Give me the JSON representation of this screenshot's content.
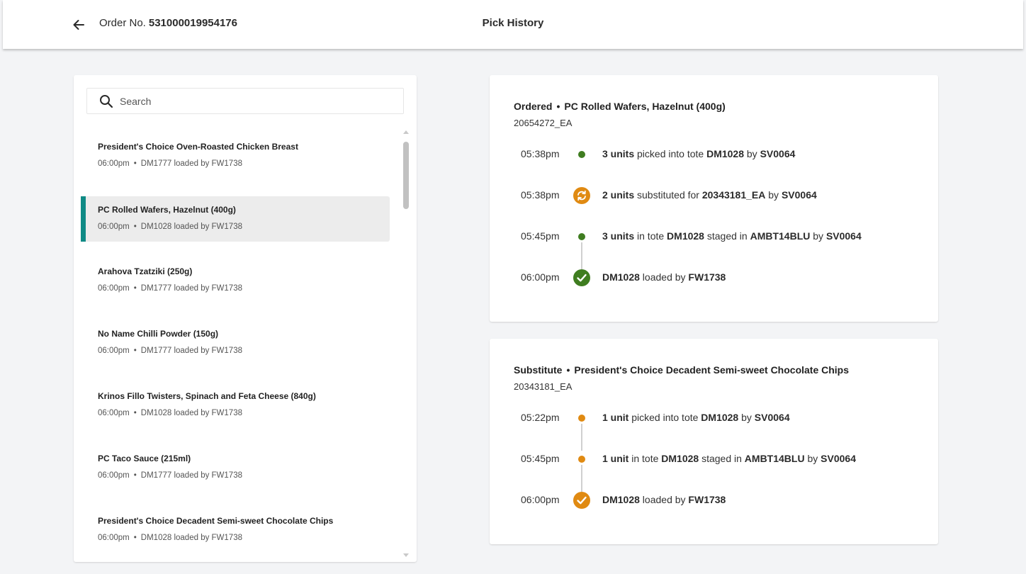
{
  "header": {
    "order_label": "Order No.",
    "order_number": "531000019954176",
    "title": "Pick History"
  },
  "search": {
    "placeholder": "Search"
  },
  "items": [
    {
      "name": "President's Choice Oven-Roasted Chicken Breast",
      "time": "06:00pm",
      "sep": "•",
      "detail": "DM1777 loaded by FW1738"
    },
    {
      "name": "PC Rolled Wafers, Hazelnut (400g)",
      "time": "06:00pm",
      "sep": "•",
      "detail": "DM1028 loaded by FW1738"
    },
    {
      "name": "Arahova Tzatziki (250g)",
      "time": "06:00pm",
      "sep": "•",
      "detail": "DM1777 loaded by FW1738"
    },
    {
      "name": "No Name Chilli Powder (150g)",
      "time": "06:00pm",
      "sep": "•",
      "detail": "DM1777 loaded by FW1738"
    },
    {
      "name": "Krinos Fillo Twisters, Spinach and Feta Cheese (840g)",
      "time": "06:00pm",
      "sep": "•",
      "detail": "DM1028 loaded by FW1738"
    },
    {
      "name": "PC Taco Sauce (215ml)",
      "time": "06:00pm",
      "sep": "•",
      "detail": "DM1777 loaded by FW1738"
    },
    {
      "name": "President's Choice Decadent Semi-sweet Chocolate Chips",
      "time": "06:00pm",
      "sep": "•",
      "detail": "DM1028 loaded by FW1738"
    }
  ],
  "selected_item": "PC Rolled Wafers, Hazelnut (400g)",
  "ordered": {
    "type": "Ordered",
    "sep": "•",
    "product": "PC Rolled Wafers, Hazelnut (400g)",
    "sku": "20654272_EA",
    "events": [
      {
        "time": "05:38pm",
        "marker": "green-dot",
        "p1": "3 units",
        "t1": " picked into tote ",
        "p2": "DM1028",
        "t2": " by ",
        "p3": "SV0064"
      },
      {
        "time": "05:38pm",
        "marker": "orange-substitute-icon",
        "p1": "2 units",
        "t1": " substituted for ",
        "p2": "20343181_EA",
        "t2": " by ",
        "p3": "SV0064"
      },
      {
        "time": "05:45pm",
        "marker": "green-dot",
        "p1": "3 units",
        "t1": " in tote ",
        "p2": "DM1028",
        "t2": " staged in ",
        "p3": "AMBT14BLU",
        "t3": " by ",
        "p4": "SV0064"
      },
      {
        "time": "06:00pm",
        "marker": "green-check-icon",
        "p1": "DM1028",
        "t1": " loaded by ",
        "p2": "FW1738"
      }
    ]
  },
  "substitute": {
    "type": "Substitute",
    "sep": "•",
    "product": "President's Choice Decadent Semi-sweet Chocolate Chips",
    "sku": "20343181_EA",
    "events": [
      {
        "time": "05:22pm",
        "marker": "orange-dot",
        "p1": "1 unit",
        "t1": " picked into tote ",
        "p2": "DM1028",
        "t2": " by ",
        "p3": "SV0064"
      },
      {
        "time": "05:45pm",
        "marker": "orange-dot",
        "p1": "1 unit",
        "t1": " in tote ",
        "p2": "DM1028",
        "t2": " staged in ",
        "p3": "AMBT14BLU",
        "t3": " by ",
        "p4": "SV0064"
      },
      {
        "time": "06:00pm",
        "marker": "orange-check-icon",
        "p1": "DM1028",
        "t1": " loaded by ",
        "p2": "FW1738"
      }
    ]
  },
  "colors": {
    "accent_teal": "#0f8a85",
    "green": "#3f7d20",
    "orange": "#e08a12"
  }
}
